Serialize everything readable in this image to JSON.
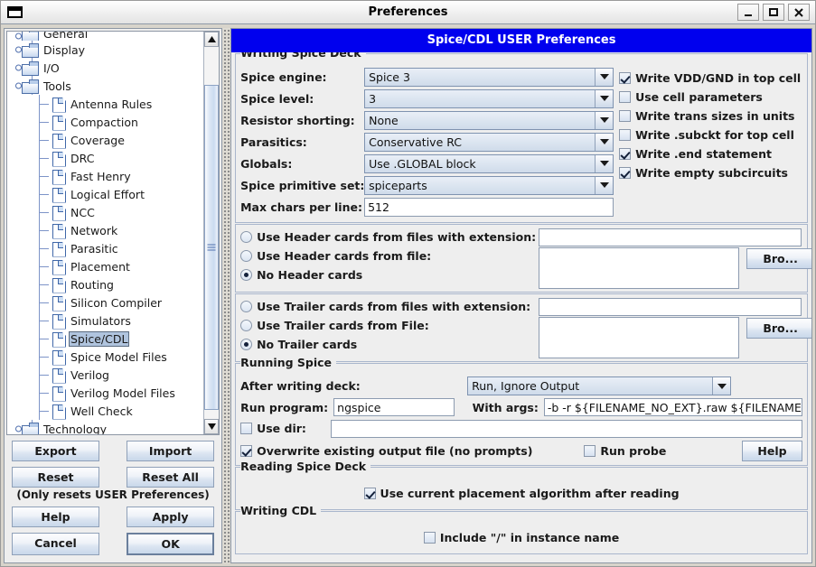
{
  "window": {
    "title": "Preferences",
    "minimize_label": "Minimize",
    "maximize_label": "Maximize",
    "close_label": "Close"
  },
  "panel_header": "Spice/CDL USER Preferences",
  "tree": {
    "items": [
      {
        "label": "General",
        "level": 1,
        "type": "folder",
        "expandable": true,
        "selected": false,
        "partial": true
      },
      {
        "label": "Display",
        "level": 1,
        "type": "folder",
        "expandable": true,
        "selected": false
      },
      {
        "label": "I/O",
        "level": 1,
        "type": "folder",
        "expandable": true,
        "selected": false
      },
      {
        "label": "Tools",
        "level": 1,
        "type": "folder",
        "expandable": true,
        "selected": false,
        "expanded": true
      },
      {
        "label": "Antenna Rules",
        "level": 2,
        "type": "file",
        "selected": false
      },
      {
        "label": "Compaction",
        "level": 2,
        "type": "file",
        "selected": false
      },
      {
        "label": "Coverage",
        "level": 2,
        "type": "file",
        "selected": false
      },
      {
        "label": "DRC",
        "level": 2,
        "type": "file",
        "selected": false
      },
      {
        "label": "Fast Henry",
        "level": 2,
        "type": "file",
        "selected": false
      },
      {
        "label": "Logical Effort",
        "level": 2,
        "type": "file",
        "selected": false
      },
      {
        "label": "NCC",
        "level": 2,
        "type": "file",
        "selected": false
      },
      {
        "label": "Network",
        "level": 2,
        "type": "file",
        "selected": false
      },
      {
        "label": "Parasitic",
        "level": 2,
        "type": "file",
        "selected": false
      },
      {
        "label": "Placement",
        "level": 2,
        "type": "file",
        "selected": false
      },
      {
        "label": "Routing",
        "level": 2,
        "type": "file",
        "selected": false
      },
      {
        "label": "Silicon Compiler",
        "level": 2,
        "type": "file",
        "selected": false
      },
      {
        "label": "Simulators",
        "level": 2,
        "type": "file",
        "selected": false
      },
      {
        "label": "Spice/CDL",
        "level": 2,
        "type": "file",
        "selected": true
      },
      {
        "label": "Spice Model Files",
        "level": 2,
        "type": "file",
        "selected": false
      },
      {
        "label": "Verilog",
        "level": 2,
        "type": "file",
        "selected": false
      },
      {
        "label": "Verilog Model Files",
        "level": 2,
        "type": "file",
        "selected": false
      },
      {
        "label": "Well Check",
        "level": 2,
        "type": "file",
        "selected": false
      },
      {
        "label": "Technology",
        "level": 1,
        "type": "folder",
        "expandable": true,
        "selected": false
      }
    ]
  },
  "left_buttons": {
    "export": "Export",
    "import": "Import",
    "reset": "Reset",
    "reset_all": "Reset All",
    "reset_note": "(Only resets USER Preferences)",
    "help": "Help",
    "apply": "Apply",
    "cancel": "Cancel",
    "ok": "OK"
  },
  "writing_spice_deck": {
    "title": "Writing Spice Deck",
    "fields": [
      {
        "label": "Spice engine:",
        "value": "Spice 3",
        "type": "combo"
      },
      {
        "label": "Spice level:",
        "value": "3",
        "type": "combo"
      },
      {
        "label": "Resistor shorting:",
        "value": "None",
        "type": "combo"
      },
      {
        "label": "Parasitics:",
        "value": "Conservative RC",
        "type": "combo"
      },
      {
        "label": "Globals:",
        "value": "Use .GLOBAL block",
        "type": "combo"
      },
      {
        "label": "Spice primitive set:",
        "value": "spiceparts",
        "type": "combo"
      },
      {
        "label": "Max chars per line:",
        "value": "512",
        "type": "text"
      }
    ],
    "checkboxes": [
      {
        "label": "Write VDD/GND in top cell",
        "checked": true
      },
      {
        "label": "Use cell parameters",
        "checked": false
      },
      {
        "label": "Write trans sizes in units",
        "checked": false
      },
      {
        "label": "Write .subckt for top cell",
        "checked": false
      },
      {
        "label": "Write .end statement",
        "checked": true
      },
      {
        "label": "Write empty subcircuits",
        "checked": true
      }
    ]
  },
  "header_cards": {
    "radios": [
      {
        "label": "Use Header cards from files with extension:",
        "selected": false
      },
      {
        "label": "Use Header cards from file:",
        "selected": false
      },
      {
        "label": "No Header cards",
        "selected": true
      }
    ],
    "extension_value": "",
    "file_value": "",
    "browse_label": "Bro..."
  },
  "trailer_cards": {
    "radios": [
      {
        "label": "Use Trailer cards from files with extension:",
        "selected": false
      },
      {
        "label": "Use Trailer cards from File:",
        "selected": false
      },
      {
        "label": "No Trailer cards",
        "selected": true
      }
    ],
    "extension_value": "",
    "file_value": "",
    "browse_label": "Bro..."
  },
  "running_spice": {
    "title": "Running Spice",
    "after_writing_deck_label": "After writing deck:",
    "after_writing_deck_value": "Run, Ignore Output",
    "run_program_label": "Run program:",
    "run_program_value": "ngspice",
    "with_args_label": "With args:",
    "with_args_value": "-b -r ${FILENAME_NO_EXT}.raw ${FILENAME}",
    "use_dir_label": "Use dir:",
    "use_dir_checked": false,
    "use_dir_value": "",
    "overwrite_label": "Overwrite existing output file (no prompts)",
    "overwrite_checked": true,
    "run_probe_label": "Run probe",
    "run_probe_checked": false,
    "help_label": "Help"
  },
  "reading_spice_deck": {
    "title": "Reading Spice Deck",
    "checkbox_label": "Use current placement algorithm after reading",
    "checked": true
  },
  "writing_cdl": {
    "title": "Writing CDL",
    "checkbox_label": "Include \"/\" in instance name",
    "checked": false
  },
  "colors": {
    "header_blue": "#0000ee",
    "selection": "#b0c4de",
    "panel_bg": "#eeeeee"
  }
}
